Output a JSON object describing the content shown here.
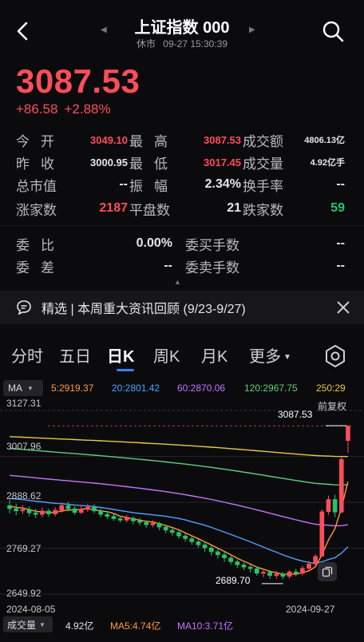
{
  "header": {
    "title": "上证指数 000",
    "status": "休市",
    "datetime": "09-27 15:30:39"
  },
  "quote": {
    "price": "3087.53",
    "change": "+86.58",
    "change_pct": "+2.88%"
  },
  "stats": {
    "open_label": "今开",
    "open": "3049.10",
    "high_label": "最高",
    "high": "3087.53",
    "turnover_label": "成交额",
    "turnover": "4806.13亿",
    "prev_label": "昨收",
    "prev": "3000.95",
    "low_label": "最低",
    "low": "3017.45",
    "volume_label": "成交量",
    "volume": "4.92亿手",
    "mcap_label": "总市值",
    "mcap": "--",
    "amp_label": "振幅",
    "amp": "2.34%",
    "turnrate_label": "换手率",
    "turnrate": "--",
    "up_label": "涨家数",
    "up": "2187",
    "flat_label": "平盘数",
    "flat": "21",
    "down_label": "跌家数",
    "down": "59",
    "ratio_label": "委比",
    "ratio": "0.00%",
    "buyvol_label": "委买手数",
    "buyvol": "--",
    "diff_label": "委差",
    "diff": "--",
    "sellvol_label": "委卖手数",
    "sellvol": "--"
  },
  "news": {
    "text": "精选 | 本周重大资讯回顾 (9/23-9/27)"
  },
  "tabs": [
    "分时",
    "五日",
    "日K",
    "周K",
    "月K",
    "更多"
  ],
  "indicator": {
    "ma_label": "MA",
    "ma5": "5:2919.37",
    "ma20": "20:2801.42",
    "ma60": "60:2870.06",
    "ma120": "120:2967.75",
    "ma250": "250:29",
    "adjust_label": "前复权"
  },
  "colors": {
    "up": "#ff4d5a",
    "down": "#27c46b",
    "ma5": "#ff9a3c",
    "ma20": "#4ea1ff",
    "ma60": "#c673ff",
    "ma120": "#5fd07a",
    "ma250": "#e7c84a"
  },
  "volume": {
    "label": "成交量",
    "value": "4.92亿",
    "ma5": "MA5:4.74亿",
    "ma10": "MA10:3.71亿"
  },
  "chart_data": {
    "type": "candlestick",
    "y_ticks": [
      "3127.31",
      "3007.96",
      "2888.62",
      "2769.27",
      "2649.92"
    ],
    "ylim": [
      2649.92,
      3127.31
    ],
    "x_ticks": [
      "2024-08-05",
      "2024-09-27"
    ],
    "annotations": {
      "high": "3087.53",
      "low": "2689.70"
    },
    "candles": [
      [
        2880,
        2872,
        2895,
        2860
      ],
      [
        2872,
        2866,
        2885,
        2855
      ],
      [
        2866,
        2870,
        2882,
        2858
      ],
      [
        2870,
        2861,
        2878,
        2852
      ],
      [
        2861,
        2857,
        2872,
        2848
      ],
      [
        2857,
        2866,
        2875,
        2850
      ],
      [
        2866,
        2858,
        2872,
        2850
      ],
      [
        2858,
        2868,
        2876,
        2852
      ],
      [
        2868,
        2880,
        2888,
        2862
      ],
      [
        2880,
        2872,
        2890,
        2865
      ],
      [
        2872,
        2862,
        2878,
        2856
      ],
      [
        2862,
        2870,
        2880,
        2858
      ],
      [
        2870,
        2876,
        2885,
        2864
      ],
      [
        2876,
        2866,
        2884,
        2860
      ],
      [
        2866,
        2857,
        2872,
        2850
      ],
      [
        2857,
        2852,
        2866,
        2845
      ],
      [
        2852,
        2846,
        2860,
        2840
      ],
      [
        2846,
        2842,
        2854,
        2836
      ],
      [
        2842,
        2847,
        2856,
        2836
      ],
      [
        2847,
        2840,
        2852,
        2832
      ],
      [
        2840,
        2836,
        2848,
        2828
      ],
      [
        2836,
        2830,
        2842,
        2822
      ],
      [
        2830,
        2834,
        2842,
        2824
      ],
      [
        2834,
        2824,
        2838,
        2816
      ],
      [
        2824,
        2816,
        2830,
        2808
      ],
      [
        2816,
        2810,
        2822,
        2802
      ],
      [
        2810,
        2801,
        2816,
        2794
      ],
      [
        2801,
        2794,
        2808,
        2786
      ],
      [
        2794,
        2786,
        2800,
        2778
      ],
      [
        2786,
        2778,
        2792,
        2770
      ],
      [
        2778,
        2770,
        2786,
        2760
      ],
      [
        2770,
        2760,
        2776,
        2750
      ],
      [
        2760,
        2752,
        2768,
        2742
      ],
      [
        2752,
        2744,
        2760,
        2734
      ],
      [
        2744,
        2734,
        2750,
        2726
      ],
      [
        2734,
        2726,
        2740,
        2718
      ],
      [
        2726,
        2720,
        2732,
        2712
      ],
      [
        2720,
        2716,
        2726,
        2706
      ],
      [
        2716,
        2704,
        2722,
        2698
      ],
      [
        2704,
        2707,
        2716,
        2694
      ],
      [
        2707,
        2698,
        2712,
        2690
      ],
      [
        2698,
        2702,
        2710,
        2690
      ],
      [
        2702,
        2696,
        2708,
        2688
      ],
      [
        2696,
        2708,
        2712,
        2690
      ],
      [
        2708,
        2704,
        2716,
        2696
      ],
      [
        2704,
        2717,
        2724,
        2698
      ],
      [
        2717,
        2728,
        2736,
        2712
      ],
      [
        2728,
        2748,
        2754,
        2722
      ],
      [
        2748,
        2864,
        2870,
        2748
      ],
      [
        2864,
        2896,
        2906,
        2856
      ],
      [
        2896,
        2863,
        2908,
        2850
      ],
      [
        2863,
        3000,
        3006,
        2860
      ],
      [
        3049,
        3087,
        3088,
        3017
      ]
    ]
  }
}
